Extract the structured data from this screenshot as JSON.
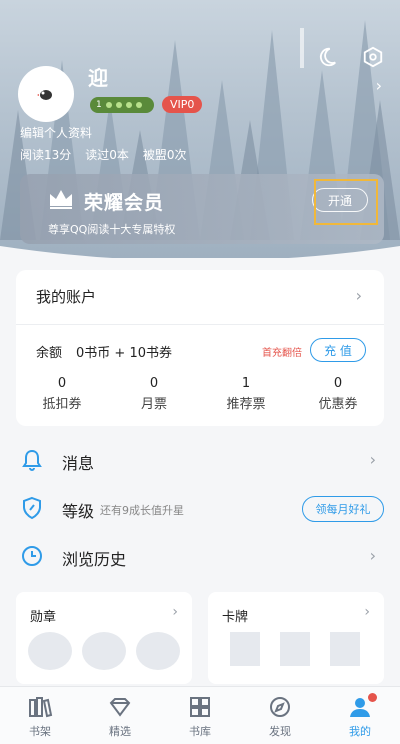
{
  "header": {
    "username": "迎",
    "level_badge": "1",
    "vip_badge": "VIP0",
    "edit_profile": "编辑个人资料",
    "stats": [
      "阅读13分",
      "读过0本",
      "被盟0次"
    ],
    "icons": [
      "moon-icon",
      "settings-hex-icon"
    ]
  },
  "vip_card": {
    "title": "荣耀会员",
    "subtitle": "尊享QQ阅读十大专属特权",
    "open_label": "开通"
  },
  "account": {
    "title": "我的账户",
    "balance_label": "余额",
    "balance_value": "0书币 + 10书券",
    "first_charge": "首充翻倍",
    "recharge_label": "充 值",
    "vouchers": [
      {
        "num": "0",
        "label": "抵扣券"
      },
      {
        "num": "0",
        "label": "月票"
      },
      {
        "num": "1",
        "label": "推荐票"
      },
      {
        "num": "0",
        "label": "优惠券"
      }
    ]
  },
  "menu": {
    "messages": "消息",
    "level": "等级",
    "level_sub": "还有9成长值升星",
    "monthly_gift": "领每月好礼",
    "history": "浏览历史"
  },
  "panels": {
    "medals": "勋章",
    "cards": "卡牌"
  },
  "bottom_nav": [
    {
      "label": "书架",
      "icon": "bookshelf-icon"
    },
    {
      "label": "精选",
      "icon": "diamond-icon"
    },
    {
      "label": "书库",
      "icon": "grid-icon"
    },
    {
      "label": "发现",
      "icon": "compass-icon"
    },
    {
      "label": "我的",
      "icon": "user-icon"
    }
  ],
  "colors": {
    "accent": "#2f9be8",
    "alert": "#e5544b",
    "highlight": "#f1b83a"
  }
}
